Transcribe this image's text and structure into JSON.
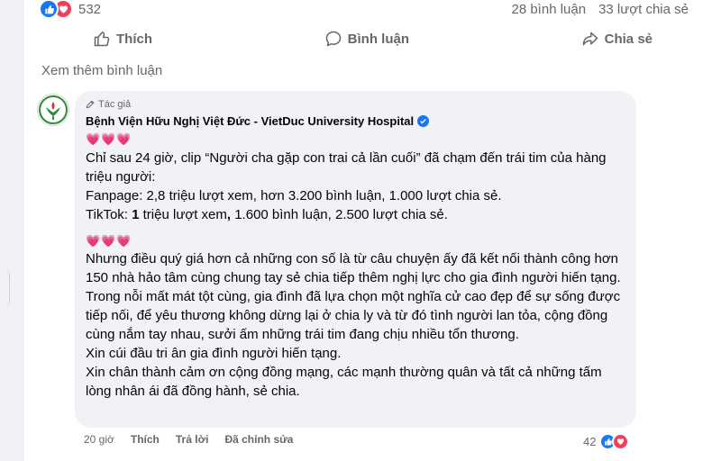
{
  "post": {
    "reaction_count": "532",
    "comment_count": "28 bình luận",
    "share_count": "33 lượt chia sẻ",
    "reaction_icons": [
      "like-icon",
      "love-icon"
    ]
  },
  "actions": {
    "like": "Thích",
    "comment": "Bình luận",
    "share": "Chia sẻ"
  },
  "see_more_comments": "Xem thêm bình luận",
  "comment": {
    "author_tag": "Tác giả",
    "author_name": "Bệnh Viện Hữu Nghị Việt Đức - VietDuc University Hospital",
    "hearts": "💗💗💗",
    "paragraph1": [
      "Chỉ sau 24 giờ, clip “Người cha gặp con trai cả lần cuối” đã chạm đến trái tim của hàng triệu người:",
      "Fanpage: 2,8 triệu lượt xem, hơn 3.200 bình luận, 1.000 lượt chia sẻ."
    ],
    "tiktok_bold": "1",
    "tiktok_prefix": "TikTok: ",
    "tiktok_rest": " triệu lượt xem",
    "tiktok_tail": " 1.600 bình luận, 2.500 lượt chia sẻ.",
    "paragraph2": [
      "Nhưng điều quý giá hơn cả những con số là từ câu chuyện ấy đã kết nối thành công hơn 150 nhà hảo tâm cùng chung tay sẻ chia tiếp thêm nghị lực cho gia đình người hiến tạng.",
      "Trong nỗi mất mát tột cùng, gia đình đã lựa chọn một nghĩa cử cao đẹp để sự sống được tiếp nối, để yêu thương không dừng lại ở chia ly và từ đó tình người lan tỏa, cộng đồng cùng nắm tay nhau, sưởi ấm những trái tim đang chịu nhiều tổn thương.",
      "Xin cúi đầu tri ân gia đình người hiến tạng.",
      "Xin chân thành cảm ơn cộng đồng mạng, các mạnh thường quân và tất cả những tấm lòng nhân ái đã đồng hành, sẻ chia."
    ],
    "time": "20 giờ",
    "like_label": "Thích",
    "reply_label": "Trả lời",
    "edited_label": "Đã chỉnh sửa",
    "reaction_count": "42"
  }
}
